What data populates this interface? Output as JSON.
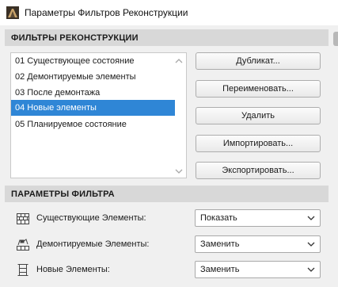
{
  "window": {
    "title": "Параметры Фильтров Реконструкции"
  },
  "filters_section": {
    "header": "ФИЛЬТРЫ РЕКОНСТРУКЦИИ",
    "items": [
      {
        "label": "01 Существующее состояние",
        "selected": false
      },
      {
        "label": "02 Демонтируемые элементы",
        "selected": false
      },
      {
        "label": "03 После демонтажа",
        "selected": false
      },
      {
        "label": "04 Новые элементы",
        "selected": true
      },
      {
        "label": "05 Планируемое состояние",
        "selected": false
      }
    ],
    "buttons": {
      "duplicate": "Дубликат...",
      "rename": "Переименовать...",
      "delete": "Удалить",
      "import": "Импортировать...",
      "export": "Экспортировать..."
    }
  },
  "params_section": {
    "header": "ПАРАМЕТРЫ ФИЛЬТРА",
    "rows": [
      {
        "label": "Существующие Элементы:",
        "value": "Показать",
        "icon": "existing-elements-icon"
      },
      {
        "label": "Демонтируемые Элементы:",
        "value": "Заменить",
        "icon": "demolished-elements-icon"
      },
      {
        "label": "Новые Элементы:",
        "value": "Заменить",
        "icon": "new-elements-icon"
      }
    ]
  },
  "colors": {
    "selection": "#2f86d6",
    "section_header_bg": "#d8d8d8",
    "window_bg": "#f0f0f0"
  }
}
